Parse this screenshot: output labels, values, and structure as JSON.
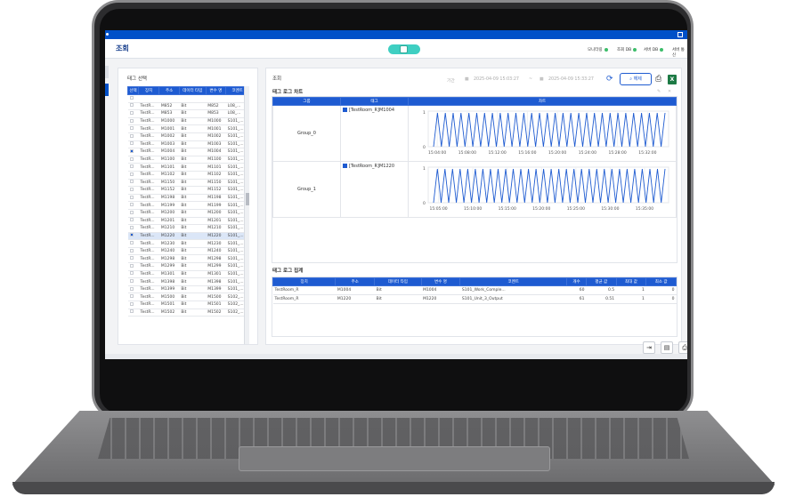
{
  "app": {
    "title": "조회",
    "status": [
      {
        "label": "모니터링",
        "color": "#3dbd6a"
      },
      {
        "label": "조회 DB",
        "color": "#3dbd6a"
      },
      {
        "label": "서버 DB",
        "color": "#3dbd6a"
      },
      {
        "label": "서버 통신",
        "color": "#3dbd6a"
      }
    ]
  },
  "tag_select": {
    "title": "태그 선택",
    "columns": [
      "선택",
      "장치",
      "주소",
      "데이터 타입",
      "변수 명",
      "코멘트"
    ],
    "rows": [
      {
        "dev": "TestR...",
        "addr": "M852",
        "type": "Bit",
        "var": "M852",
        "comment": "L08_..."
      },
      {
        "dev": "TestR...",
        "addr": "M853",
        "type": "Bit",
        "var": "M853",
        "comment": "L08_..."
      },
      {
        "dev": "TestR...",
        "addr": "M1000",
        "type": "Bit",
        "var": "M1000",
        "comment": "S101_..."
      },
      {
        "dev": "TestR...",
        "addr": "M1001",
        "type": "Bit",
        "var": "M1001",
        "comment": "S101_..."
      },
      {
        "dev": "TestR...",
        "addr": "M1002",
        "type": "Bit",
        "var": "M1002",
        "comment": "S101_..."
      },
      {
        "dev": "TestR...",
        "addr": "M1003",
        "type": "Bit",
        "var": "M1003",
        "comment": "S101_..."
      },
      {
        "dev": "TestR...",
        "addr": "M1004",
        "type": "Bit",
        "var": "M1004",
        "comment": "S101_...",
        "checked": true
      },
      {
        "dev": "TestR...",
        "addr": "M1100",
        "type": "Bit",
        "var": "M1100",
        "comment": "S101_..."
      },
      {
        "dev": "TestR...",
        "addr": "M1101",
        "type": "Bit",
        "var": "M1101",
        "comment": "S101_..."
      },
      {
        "dev": "TestR...",
        "addr": "M1102",
        "type": "Bit",
        "var": "M1102",
        "comment": "S101_..."
      },
      {
        "dev": "TestR...",
        "addr": "M1150",
        "type": "Bit",
        "var": "M1150",
        "comment": "S101_..."
      },
      {
        "dev": "TestR...",
        "addr": "M1152",
        "type": "Bit",
        "var": "M1152",
        "comment": "S101_..."
      },
      {
        "dev": "TestR...",
        "addr": "M1198",
        "type": "Bit",
        "var": "M1198",
        "comment": "S101_..."
      },
      {
        "dev": "TestR...",
        "addr": "M1199",
        "type": "Bit",
        "var": "M1199",
        "comment": "S101_..."
      },
      {
        "dev": "TestR...",
        "addr": "M1200",
        "type": "Bit",
        "var": "M1200",
        "comment": "S101_..."
      },
      {
        "dev": "TestR...",
        "addr": "M1201",
        "type": "Bit",
        "var": "M1201",
        "comment": "S101_..."
      },
      {
        "dev": "TestR...",
        "addr": "M1210",
        "type": "Bit",
        "var": "M1210",
        "comment": "S101_..."
      },
      {
        "dev": "TestR...",
        "addr": "M1220",
        "type": "Bit",
        "var": "M1220",
        "comment": "S101_...",
        "checked": true,
        "selected": true
      },
      {
        "dev": "TestR...",
        "addr": "M1230",
        "type": "Bit",
        "var": "M1230",
        "comment": "S101_..."
      },
      {
        "dev": "TestR...",
        "addr": "M1240",
        "type": "Bit",
        "var": "M1240",
        "comment": "S101_..."
      },
      {
        "dev": "TestR...",
        "addr": "M1298",
        "type": "Bit",
        "var": "M1298",
        "comment": "S101_..."
      },
      {
        "dev": "TestR...",
        "addr": "M1299",
        "type": "Bit",
        "var": "M1299",
        "comment": "S101_..."
      },
      {
        "dev": "TestR...",
        "addr": "M1301",
        "type": "Bit",
        "var": "M1301",
        "comment": "S101_..."
      },
      {
        "dev": "TestR...",
        "addr": "M1398",
        "type": "Bit",
        "var": "M1398",
        "comment": "S101_..."
      },
      {
        "dev": "TestR...",
        "addr": "M1399",
        "type": "Bit",
        "var": "M1399",
        "comment": "S101_..."
      },
      {
        "dev": "TestR...",
        "addr": "M1500",
        "type": "Bit",
        "var": "M1500",
        "comment": "S102_..."
      },
      {
        "dev": "TestR...",
        "addr": "M1501",
        "type": "Bit",
        "var": "M1501",
        "comment": "S102_..."
      },
      {
        "dev": "TestR...",
        "addr": "M1502",
        "type": "Bit",
        "var": "M1502",
        "comment": "S102_..."
      }
    ]
  },
  "query": {
    "title": "조회",
    "period_label": "기간",
    "start": "2025-04-09 15:03:27",
    "separator": "~",
    "end": "2025-04-09 15:33:27",
    "search_label": "해제"
  },
  "tag_chart": {
    "title": "태그 로그 차트",
    "columns": [
      "그룹",
      "태그",
      "차트"
    ],
    "groups": [
      {
        "name": "Group_0",
        "tag": "[TestRoom_R]M1004",
        "y_ticks": [
          "1",
          "0"
        ],
        "x_ticks": [
          "15:04:00",
          "15:08:00",
          "15:12:00",
          "15:16:00",
          "15:20:00",
          "15:24:00",
          "15:28:00",
          "15:32:00"
        ]
      },
      {
        "name": "Group_1",
        "tag": "[TestRoom_R]M1220",
        "y_ticks": [
          "1",
          "0"
        ],
        "x_ticks": [
          "15:05:00",
          "15:10:00",
          "15:15:00",
          "15:20:00",
          "15:25:00",
          "15:30:00",
          "15:35:00"
        ]
      }
    ]
  },
  "chart_data": [
    {
      "type": "line",
      "series": [
        {
          "name": "[TestRoom_R]M1004",
          "values": [
            0,
            1,
            0,
            1,
            0,
            1,
            0,
            1,
            0,
            1,
            0,
            1,
            0,
            1,
            0,
            1,
            0,
            1,
            0,
            1,
            0,
            1,
            0,
            1,
            0,
            1,
            0,
            1,
            0,
            1,
            0,
            1,
            0,
            1,
            0,
            1,
            0,
            1,
            0,
            1,
            0,
            1,
            0,
            1,
            0,
            1,
            0,
            1,
            0,
            1,
            0,
            1,
            0,
            1,
            0,
            1,
            0,
            1,
            0,
            1
          ]
        }
      ],
      "ylim": [
        0,
        1
      ]
    },
    {
      "type": "line",
      "series": [
        {
          "name": "[TestRoom_R]M1220",
          "values": [
            0,
            1,
            0,
            1,
            0,
            1,
            0,
            1,
            0,
            1,
            0,
            1,
            0,
            1,
            0,
            1,
            0,
            1,
            0,
            1,
            0,
            1,
            0,
            1,
            0,
            1,
            0,
            1,
            0,
            1,
            0,
            1,
            0,
            1,
            0,
            1,
            0,
            1,
            0,
            1,
            0,
            1,
            0,
            1,
            0,
            1,
            0,
            1,
            0,
            1,
            0,
            1,
            0,
            1,
            0,
            1,
            0,
            1,
            0,
            1,
            0,
            1
          ]
        }
      ],
      "ylim": [
        0,
        1
      ]
    }
  ],
  "tag_summary": {
    "title": "태그 로그 집계",
    "columns": [
      "장치",
      "주소",
      "데이터 타입",
      "변수 명",
      "코멘트",
      "개수",
      "평균 값",
      "최대 값",
      "최소 값"
    ],
    "rows": [
      [
        "TestRoom_R",
        "M1004",
        "Bit",
        "M1004",
        "S101_Work_Comple...",
        "60",
        "0.5",
        "1",
        "0"
      ],
      [
        "TestRoom_R",
        "M1220",
        "Bit",
        "M1220",
        "S101_Unit_3_Output",
        "61",
        "0.51",
        "1",
        "0"
      ]
    ]
  }
}
